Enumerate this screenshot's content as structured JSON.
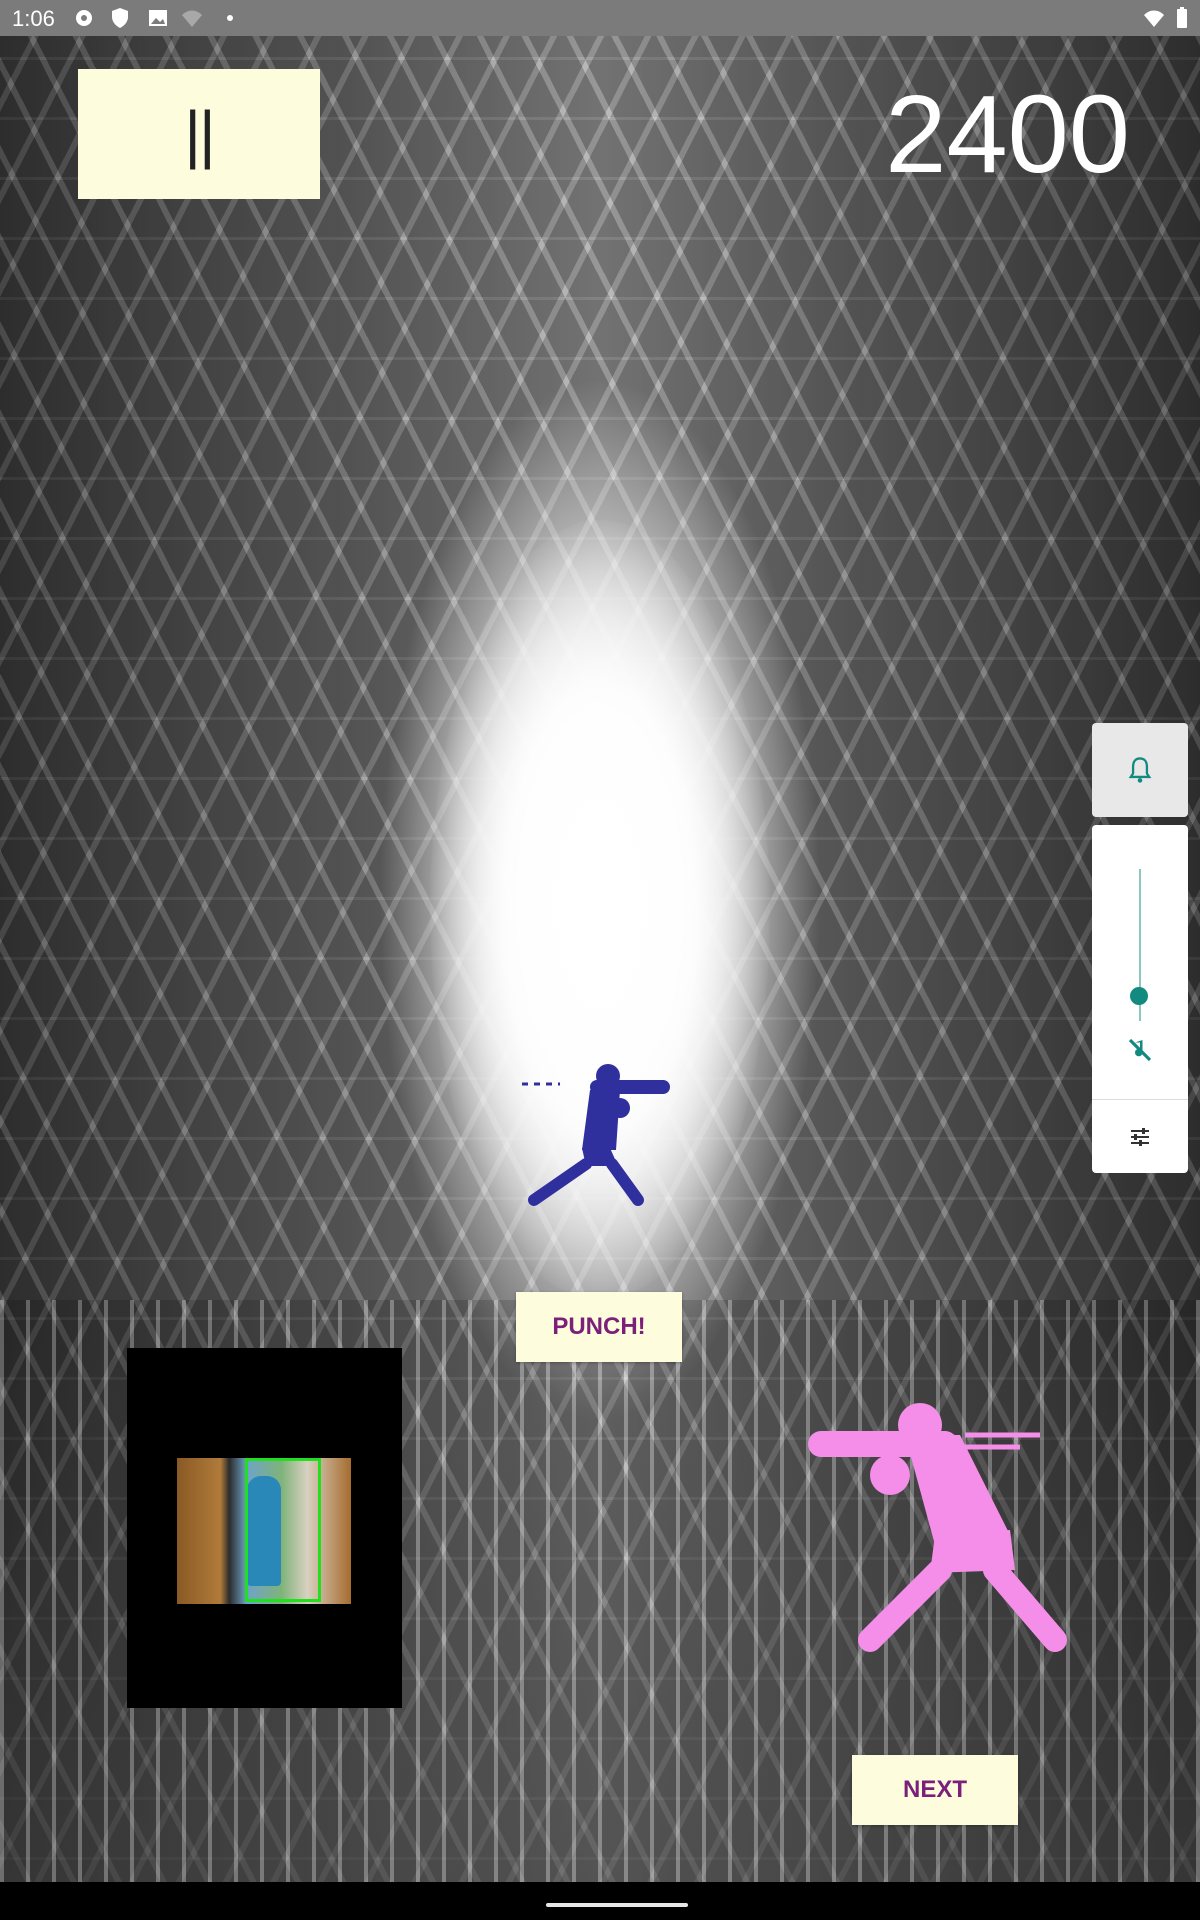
{
  "status_bar": {
    "time": "1:06",
    "left_icons": [
      "gear-icon",
      "shield-icon",
      "image-icon",
      "wifi-question-icon",
      "dot-icon"
    ],
    "right_icons": [
      "wifi-icon",
      "battery-icon"
    ]
  },
  "game": {
    "pause_label": "||",
    "score": "2400",
    "punch_label": "PUNCH!",
    "next_label": "NEXT",
    "target_figure": "boxer-blue",
    "player_figure": "boxer-pink"
  },
  "volume_panel": {
    "top_icon": "bell-icon",
    "slider_level": 0.0,
    "mute_icon": "music-off-icon",
    "settings_icon": "equalizer-icon",
    "accent_color": "#138a7f"
  },
  "colors": {
    "button_bg": "#fdfcdc",
    "button_text": "#7a1f7a",
    "blue_boxer": "#2f2f9e",
    "pink_boxer": "#f48ee8",
    "detection_box": "#20e020"
  }
}
